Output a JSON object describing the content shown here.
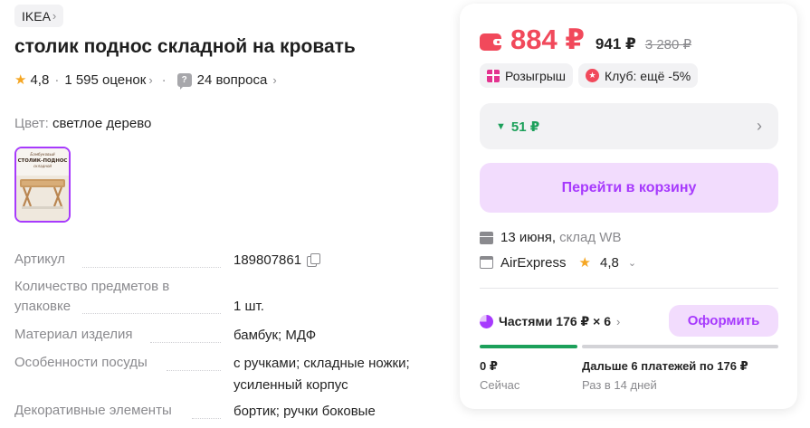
{
  "product": {
    "brand": "IKEA",
    "title": "столик поднос складной на кровать",
    "rating": "4,8",
    "reviews": "1 595 оценок",
    "questions": "24 вопроса",
    "color_label": "Цвет:",
    "color_value": "светлое дерево"
  },
  "thumbnail": {
    "line1": "Бамбуковый",
    "line2": "СТОЛИК-ПОДНОС",
    "line3": "складной"
  },
  "specs": [
    {
      "key": "Артикул",
      "value": "189807861"
    },
    {
      "key": "Количество предметов в упаковке",
      "value": "1 шт."
    },
    {
      "key": "Материал изделия",
      "value": "бамбук; МДФ"
    },
    {
      "key": "Особенности посуды",
      "value": "с ручками; складные ножки; усиленный корпус"
    },
    {
      "key": "Декоративные элементы",
      "value": "бортик; ручки боковые"
    }
  ],
  "buy": {
    "price": "884 ₽",
    "price_no_wallet": "941 ₽",
    "price_old": "3 280 ₽",
    "promo_raffle": "Розыгрыш",
    "promo_club": "Клуб: ещё -5%",
    "wallet_discount": "51 ₽",
    "cart_button": "Перейти в корзину",
    "delivery_date": "13 июня,",
    "warehouse": "склад WB",
    "seller": "AirExpress",
    "seller_rating": "4,8",
    "installments_label": "Частями 176 ₽ × 6",
    "order_button": "Оформить",
    "pay_now_amount": "0 ₽",
    "pay_now_label": "Сейчас",
    "pay_later_amount": "Дальше 6 платежей по 176 ₽",
    "pay_later_label": "Раз в 14 дней"
  },
  "colors": {
    "accent": "#a73afd",
    "price": "#f1495b",
    "wallet_green": "#1ca05a",
    "star": "#f5a623"
  }
}
